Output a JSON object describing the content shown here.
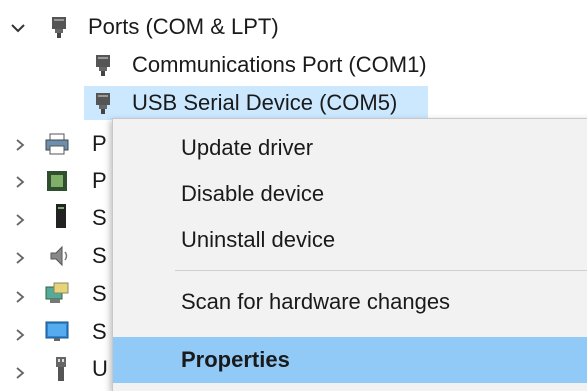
{
  "tree": {
    "ports_label": "Ports (COM & LPT)",
    "com1_label": "Communications Port (COM1)",
    "com5_label": "USB Serial Device (COM5)",
    "truncated": [
      {
        "label": "P",
        "icon": "printer-icon"
      },
      {
        "label": "P",
        "icon": "processor-icon"
      },
      {
        "label": "S",
        "icon": "storage-icon"
      },
      {
        "label": "S",
        "icon": "speaker-icon"
      },
      {
        "label": "S",
        "icon": "network-icon"
      },
      {
        "label": "S",
        "icon": "monitor-icon"
      },
      {
        "label": "U",
        "icon": "usb-icon"
      }
    ]
  },
  "context_menu": {
    "update_driver": "Update driver",
    "disable_device": "Disable device",
    "uninstall_device": "Uninstall device",
    "scan_hardware": "Scan for hardware changes",
    "properties": "Properties"
  },
  "colors": {
    "selection": "#cce8ff",
    "menu_bg": "#f2f2f2",
    "menu_hover": "#91c9f7"
  }
}
